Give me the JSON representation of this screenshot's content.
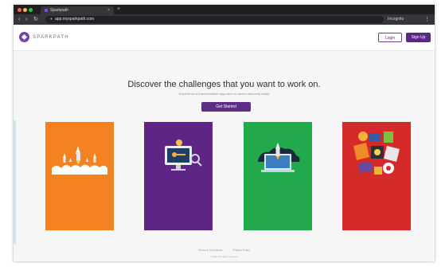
{
  "browser": {
    "tab_title": "Sparkpath",
    "tab_close": "×",
    "new_tab": "+",
    "url": "app.mysparkpath.com",
    "profile": "Incognito",
    "colors": {
      "chrome": "#1e1f21",
      "toolbar": "#353639"
    }
  },
  "header": {
    "brand": "SPARKPATH",
    "login_label": "Login",
    "signup_label": "Sign Up"
  },
  "hero": {
    "title": "Discover the challenges that you want to work on.",
    "subtitle": "Experience a transformative approach to career discovery today",
    "cta_label": "Get Started"
  },
  "cards": [
    {
      "color": "#f58220",
      "icon": "rocket-launch-icon"
    },
    {
      "color": "#5e2586",
      "icon": "monitor-magnifier-icon"
    },
    {
      "color": "#22a94b",
      "icon": "laptop-rocket-icon"
    },
    {
      "color": "#d62a2a",
      "icon": "creative-tools-icon"
    }
  ],
  "footer": {
    "links": [
      "Terms & Conditions",
      "Privacy Policy"
    ],
    "copyright": "© 2017 All rights reserved"
  }
}
